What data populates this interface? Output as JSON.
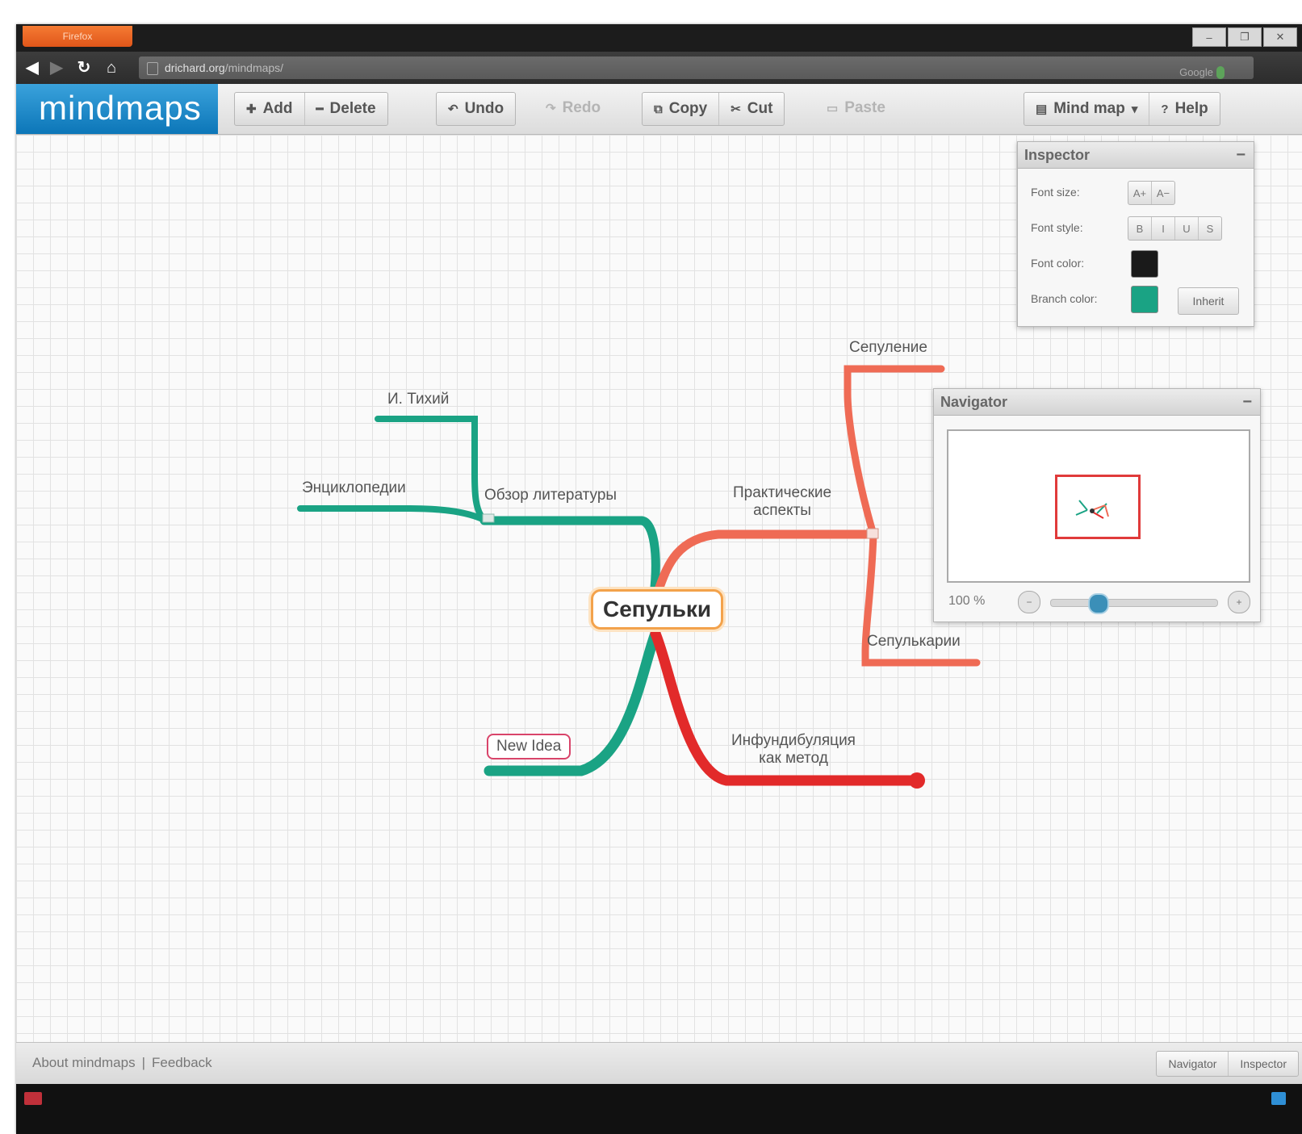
{
  "browser": {
    "menu_button": "Firefox",
    "url_host": "drichard.org",
    "url_path": "/mindmaps/",
    "search_engine": "Google",
    "window_controls": [
      "–",
      "❐",
      "✕"
    ]
  },
  "app": {
    "logo": "mindmaps",
    "toolbar": {
      "add": "Add",
      "delete": "Delete",
      "undo": "Undo",
      "redo": "Redo",
      "copy": "Copy",
      "cut": "Cut",
      "paste": "Paste",
      "mindmap_menu": "Mind map",
      "help": "Help"
    }
  },
  "mindmap": {
    "root": "Сепульки",
    "nodes": {
      "literature_review": "Обзор литературы",
      "tikhiy": "И. Тихий",
      "encyclopedias": "Энциклопедии",
      "practical_aspects_1": "Практические",
      "practical_aspects_2": "аспекты",
      "sepulenie": "Сепуление",
      "sepulkarii": "Сепулькарии",
      "infundibulation_1": "Инфундибуляция",
      "infundibulation_2": "как метод",
      "new_idea": "New Idea"
    },
    "colors": {
      "green": "#1aa384",
      "salmon": "#ef6b55",
      "red": "#e22a2a"
    }
  },
  "inspector": {
    "title": "Inspector",
    "font_size_label": "Font size:",
    "font_size_buttons": [
      "A+",
      "A−"
    ],
    "font_style_label": "Font style:",
    "font_style_buttons": [
      "B",
      "I",
      "U",
      "S"
    ],
    "font_color_label": "Font color:",
    "font_color": "#1a1a1a",
    "branch_color_label": "Branch color:",
    "branch_color": "#1aa384",
    "inherit_button": "Inherit"
  },
  "navigator": {
    "title": "Navigator",
    "zoom_label": "100 %",
    "zoom_level": 0.25
  },
  "footer": {
    "about": "About mindmaps",
    "separator": "|",
    "feedback": "Feedback",
    "navigator_btn": "Navigator",
    "inspector_btn": "Inspector"
  }
}
